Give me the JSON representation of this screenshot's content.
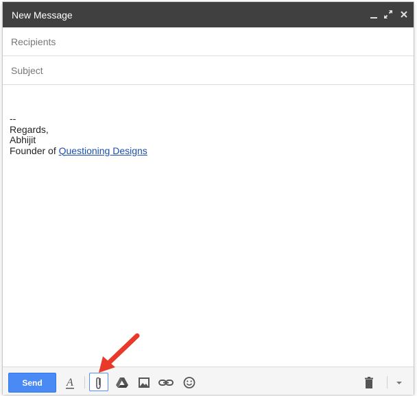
{
  "window": {
    "title": "New Message",
    "controls": [
      "minimize-icon",
      "expand-icon",
      "close-icon"
    ]
  },
  "fields": {
    "recipients_placeholder": "Recipients",
    "subject_placeholder": "Subject"
  },
  "body": {
    "sig_dash": "--",
    "regards": "Regards,",
    "name": "Abhijit",
    "founder_prefix": "Founder of ",
    "link_text": "Questioning Designs"
  },
  "toolbar": {
    "send_label": "Send",
    "format_label": "A",
    "icons": [
      "formatting-icon",
      "attach-icon",
      "drive-icon",
      "photo-icon",
      "link-icon",
      "emoji-icon",
      "trash-icon",
      "more-options-icon"
    ]
  },
  "colors": {
    "titlebar": "#404040",
    "send_button": "#4a8af4",
    "link": "#1a4fb0",
    "annotation_arrow": "#e8392a",
    "attach_highlight": "#4d90fe"
  }
}
